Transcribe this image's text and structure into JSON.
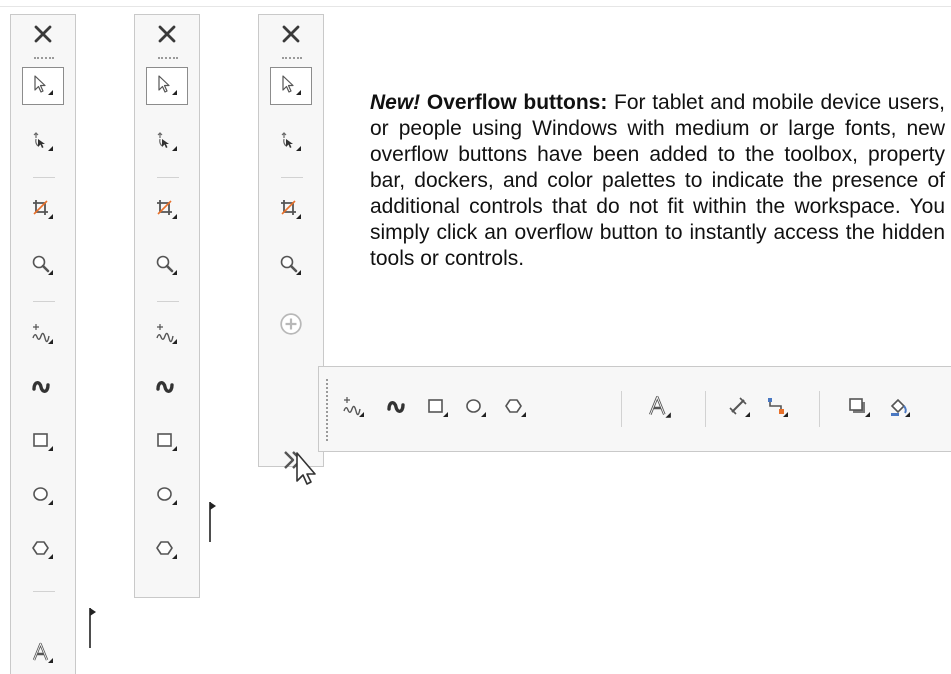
{
  "description": {
    "badge": "New!",
    "heading": "Overflow buttons:",
    "body": "For tablet and mobile device users, or people using Windows with medium or large fonts, new overflow buttons have been added to the toolbox, property bar, dockers, and color palettes to indicate the presence of additional controls that do not fit within the workspace. You simply click an overflow button to instantly access the hidden tools or controls."
  },
  "toolboxes": [
    {
      "name": "full-toolbox",
      "tools": [
        "pick-tool-icon",
        "shape-tool-icon",
        "crop-tool-icon",
        "zoom-tool-icon",
        "freehand-tool-icon",
        "artistic-media-tool-icon",
        "rectangle-tool-icon",
        "ellipse-tool-icon",
        "polygon-tool-icon",
        "text-tool-icon"
      ]
    },
    {
      "name": "shortened-toolbox",
      "tools": [
        "pick-tool-icon",
        "shape-tool-icon",
        "crop-tool-icon",
        "zoom-tool-icon",
        "freehand-tool-icon",
        "artistic-media-tool-icon",
        "rectangle-tool-icon",
        "ellipse-tool-icon",
        "polygon-tool-icon"
      ]
    },
    {
      "name": "overflow-toolbox",
      "tools": [
        "pick-tool-icon",
        "shape-tool-icon",
        "crop-tool-icon",
        "zoom-tool-icon",
        "add-tool-icon"
      ],
      "overflow_button": "overflow-chevron-icon"
    }
  ],
  "overflow_flyout": {
    "tools": [
      "freehand-tool-icon",
      "artistic-media-tool-icon",
      "rectangle-tool-icon",
      "ellipse-tool-icon",
      "polygon-tool-icon",
      "text-tool-icon",
      "parallel-dimension-tool-icon",
      "connector-tool-icon",
      "drop-shadow-tool-icon",
      "fill-tool-icon"
    ]
  },
  "colors": {
    "toolbox_bg": "#f7f7f7",
    "border": "#c9c9c9",
    "icon": "#3a3a3a",
    "accent_orange": "#e8702a",
    "accent_blue": "#4a78c2"
  }
}
